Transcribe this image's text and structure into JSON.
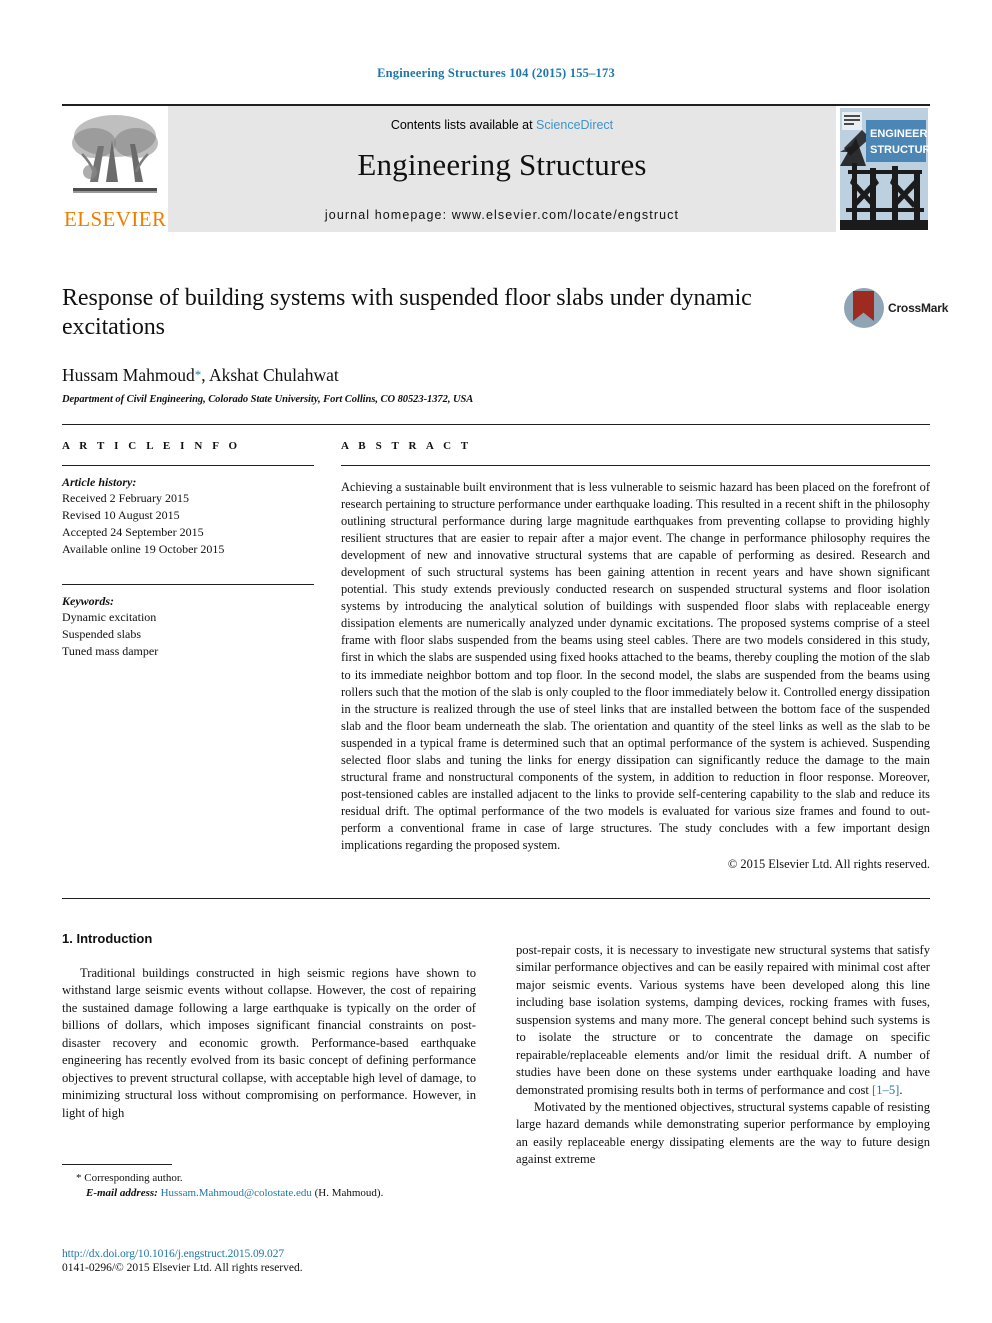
{
  "running_head": "Engineering Structures 104 (2015) 155–173",
  "masthead": {
    "publisher_name": "ELSEVIER",
    "contents_prefix": "Contents lists available at ",
    "contents_link": "ScienceDirect",
    "journal_title": "Engineering Structures",
    "homepage": "journal homepage: www.elsevier.com/locate/engstruct",
    "cover_title_line1": "ENGINEERING",
    "cover_title_line2": "STRUCTURES"
  },
  "article": {
    "title": "Response of building systems with suspended floor slabs under dynamic excitations",
    "crossmark_label": "CrossMark",
    "authors": "Hussam Mahmoud",
    "authors_rest": ", Akshat Chulahwat",
    "corresponding_marker": "*",
    "affiliation": "Department of Civil Engineering, Colorado State University, Fort Collins, CO 80523-1372, USA"
  },
  "article_info": {
    "heading": "A R T I C L E   I N F O",
    "history_label": "Article history:",
    "history": [
      "Received 2 February 2015",
      "Revised 10 August 2015",
      "Accepted 24 September 2015",
      "Available online 19 October 2015"
    ],
    "keywords_label": "Keywords:",
    "keywords": [
      "Dynamic excitation",
      "Suspended slabs",
      "Tuned mass damper"
    ]
  },
  "abstract": {
    "heading": "A B S T R A C T",
    "text": "Achieving a sustainable built environment that is less vulnerable to seismic hazard has been placed on the forefront of research pertaining to structure performance under earthquake loading. This resulted in a recent shift in the philosophy outlining structural performance during large magnitude earthquakes from preventing collapse to providing highly resilient structures that are easier to repair after a major event. The change in performance philosophy requires the development of new and innovative structural systems that are capable of performing as desired. Research and development of such structural systems has been gaining attention in recent years and have shown significant potential. This study extends previously conducted research on suspended structural systems and floor isolation systems by introducing the analytical solution of buildings with suspended floor slabs with replaceable energy dissipation elements are numerically analyzed under dynamic excitations. The proposed systems comprise of a steel frame with floor slabs suspended from the beams using steel cables. There are two models considered in this study, first in which the slabs are suspended using fixed hooks attached to the beams, thereby coupling the motion of the slab to its immediate neighbor bottom and top floor. In the second model, the slabs are suspended from the beams using rollers such that the motion of the slab is only coupled to the floor immediately below it. Controlled energy dissipation in the structure is realized through the use of steel links that are installed between the bottom face of the suspended slab and the floor beam underneath the slab. The orientation and quantity of the steel links as well as the slab to be suspended in a typical frame is determined such that an optimal performance of the system is achieved. Suspending selected floor slabs and tuning the links for energy dissipation can significantly reduce the damage to the main structural frame and nonstructural components of the system, in addition to reduction in floor response. Moreover, post-tensioned cables are installed adjacent to the links to provide self-centering capability to the slab and reduce its residual drift. The optimal performance of the two models is evaluated for various size frames and found to out-perform a conventional frame in case of large structures. The study concludes with a few important design implications regarding the proposed system.",
    "copyright": "© 2015 Elsevier Ltd. All rights reserved."
  },
  "body": {
    "section_heading": "1. Introduction",
    "left_paragraph": "Traditional buildings constructed in high seismic regions have shown to withstand large seismic events without collapse. However, the cost of repairing the sustained damage following a large earthquake is typically on the order of billions of dollars, which imposes significant financial constraints on post-disaster recovery and economic growth. Performance-based earthquake engineering has recently evolved from its basic concept of defining performance objectives to prevent structural collapse, with acceptable high level of damage, to minimizing structural loss without compromising on performance. However, in light of high",
    "right_paragraph_1_a": "post-repair costs, it is necessary to investigate new structural systems that satisfy similar performance objectives and can be easily repaired with minimal cost after major seismic events. Various systems have been developed along this line including base isolation systems, damping devices, rocking frames with fuses, suspension systems and many more. The general concept behind such systems is to isolate the structure or to concentrate the damage on specific repairable/replaceable elements and/or limit the residual drift. A number of studies have been done on these systems under earthquake loading and have demonstrated promising results both in terms of performance and cost ",
    "right_paragraph_1_cite": "[1–5]",
    "right_paragraph_1_b": ".",
    "right_paragraph_2": "Motivated by the mentioned objectives, structural systems capable of resisting large hazard demands while demonstrating superior performance by employing an easily replaceable energy dissipating elements are the way to future design against extreme"
  },
  "footnote": {
    "corresponding_star": "*",
    "corresponding_text": " Corresponding author.",
    "email_label": "E-mail address:",
    "email": "Hussam.Mahmoud@colostate.edu",
    "email_suffix": " (H. Mahmoud)."
  },
  "footer": {
    "doi": "http://dx.doi.org/10.1016/j.engstruct.2015.09.027",
    "issn": "0141-0296/© 2015 Elsevier Ltd. All rights reserved."
  },
  "colors": {
    "link_blue": "#1f76a8",
    "sciencedirect_blue": "#3f93c8",
    "elsevier_orange": "#f07d00",
    "banner_gray": "#e6e6e6",
    "crossmark_red": "#9e2b20",
    "cover_blue": "#4b86b4"
  }
}
